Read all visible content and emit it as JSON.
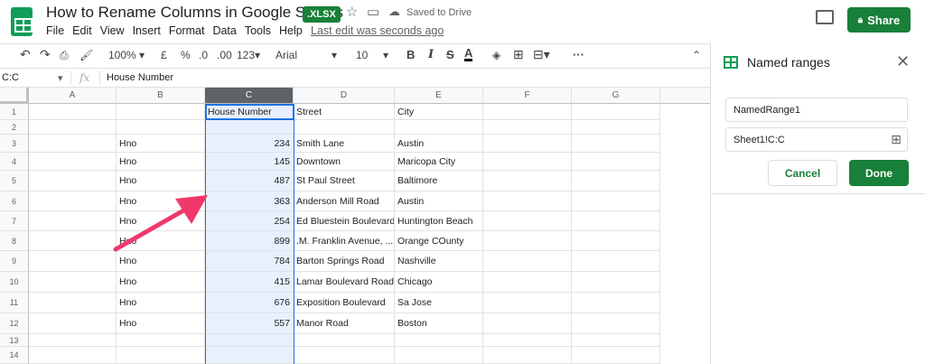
{
  "header": {
    "doc_title": "How to Rename Columns in Google Sheets",
    "file_badge": ".XLSX",
    "saved_status": "Saved to Drive",
    "last_edit": "Last edit was seconds ago",
    "share_label": "Share",
    "menu": [
      "File",
      "Edit",
      "View",
      "Insert",
      "Format",
      "Data",
      "Tools",
      "Help"
    ]
  },
  "toolbar": {
    "zoom": "100%",
    "currency": "£",
    "percent": "%",
    "dec_decrease": ".0",
    "dec_increase": ".00",
    "format_more": "123",
    "font": "Arial",
    "font_size": "10",
    "bold": "B",
    "italic": "I",
    "strike": "S",
    "text_color": "A",
    "more": "···"
  },
  "formula_bar": {
    "name_box": "C:C",
    "fx": "fx",
    "value": "House Number"
  },
  "grid": {
    "columns": [
      "A",
      "B",
      "C",
      "D",
      "E",
      "F",
      "G"
    ],
    "selected_column": "C",
    "rows": [
      {
        "n": "1",
        "b": "",
        "c": "House Number",
        "d": "Street",
        "e": "City"
      },
      {
        "n": "2",
        "b": "",
        "c": "",
        "d": "",
        "e": ""
      },
      {
        "n": "3",
        "b": "Hno",
        "c": "234",
        "d": "Smith Lane",
        "e": "Austin"
      },
      {
        "n": "4",
        "b": "Hno",
        "c": "145",
        "d": "Downtown",
        "e": "Maricopa City"
      },
      {
        "n": "5",
        "b": "Hno",
        "c": "487",
        "d": "St Paul Street",
        "e": "Baltimore"
      },
      {
        "n": "6",
        "b": "Hno",
        "c": "363",
        "d": "Anderson Mill Road",
        "e": "Austin"
      },
      {
        "n": "7",
        "b": "Hno",
        "c": "254",
        "d": "Ed Bluestein Boulevard",
        "e": "Huntington Beach"
      },
      {
        "n": "8",
        "b": "Hno",
        "c": "899",
        "d": ".M. Franklin Avenue, ...",
        "e": "Orange COunty"
      },
      {
        "n": "9",
        "b": "Hno",
        "c": "784",
        "d": "Barton Springs Road",
        "e": "Nashville"
      },
      {
        "n": "10",
        "b": "Hno",
        "c": "415",
        "d": "Lamar Boulevard Road",
        "e": "Chicago"
      },
      {
        "n": "11",
        "b": "Hno",
        "c": "676",
        "d": "Exposition Boulevard",
        "e": "Sa Jose"
      },
      {
        "n": "12",
        "b": "Hno",
        "c": "557",
        "d": "Manor Road",
        "e": "Boston"
      },
      {
        "n": "13",
        "b": "",
        "c": "",
        "d": "",
        "e": ""
      },
      {
        "n": "14",
        "b": "",
        "c": "",
        "d": "",
        "e": ""
      }
    ]
  },
  "named_ranges_panel": {
    "title": "Named ranges",
    "name_value": "NamedRange1",
    "range_value": "Sheet1!C:C",
    "cancel_label": "Cancel",
    "done_label": "Done"
  },
  "colors": {
    "accent_green": "#188038",
    "selection_blue": "#1a73e8",
    "arrow_pink": "#f0386b"
  }
}
